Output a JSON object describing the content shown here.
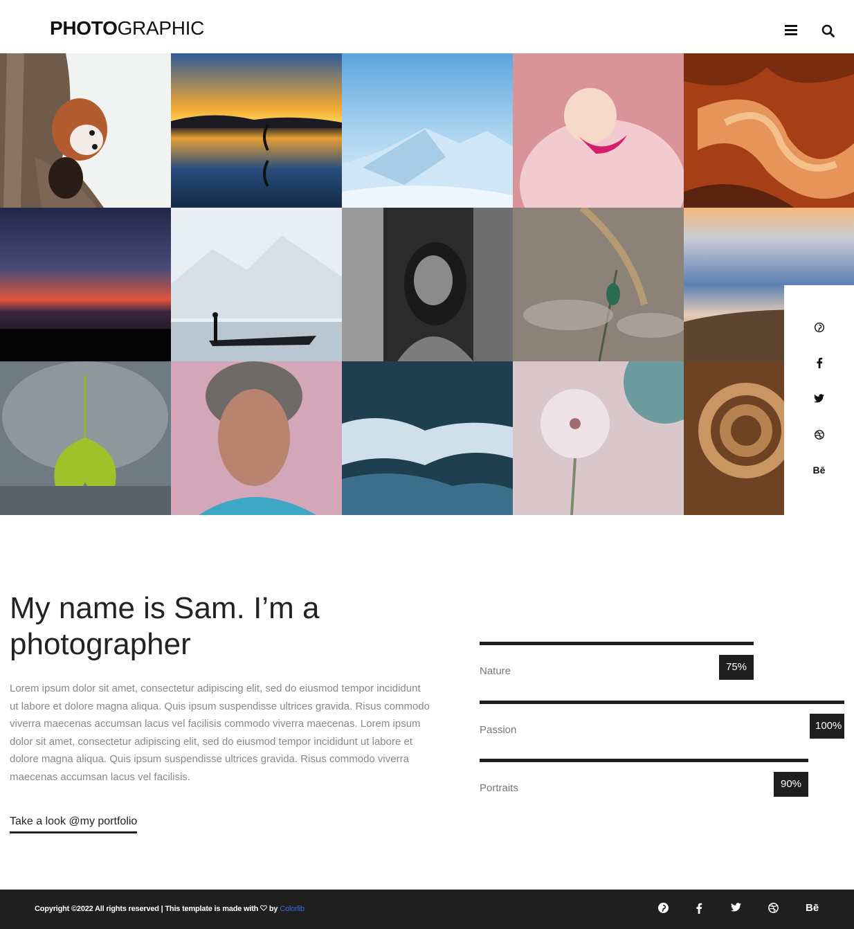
{
  "header": {
    "logo_bold": "PHOTO",
    "logo_light": "GRAPHIC",
    "menu_icon": "hamburger-menu-icon",
    "search_icon": "search-icon"
  },
  "gallery": {
    "photos": [
      "red-panda-in-tree",
      "sunset-lake-yoga-reflection",
      "snowy-mountains",
      "pink-flamingo",
      "antelope-canyon-rock",
      "starry-sky-red-sunset",
      "misty-lake-boatman",
      "girl-black-and-white",
      "dragonfly-on-stem",
      "clouds-above-mountains",
      "ginkgo-leaf-on-buddha",
      "elderly-woman-portrait",
      "ocean-waves",
      "pink-flower-closeup",
      "coiled-rope"
    ]
  },
  "side_social": {
    "icons": [
      "pinterest-icon",
      "facebook-icon",
      "twitter-icon",
      "dribbble-icon",
      "behance-icon"
    ],
    "behance_label": "Bē"
  },
  "about": {
    "title": "My name is Sam. I’m a photographer",
    "text": "Lorem ipsum dolor sit amet, consectetur adipiscing elit, sed do eiusmod tempor incididunt ut labore et dolore magna aliqua. Quis ipsum suspendisse ultrices gravida. Risus commodo viverra maecenas accumsan lacus vel facilisis commodo viverra maecenas. Lorem ipsum dolor sit amet, consectetur adipiscing elit, sed do eiusmod tempor incididunt ut labore et dolore magna aliqua. Quis ipsum suspendisse ultrices gravida. Risus commodo viverra maecenas accumsan lacus vel facilisis.",
    "link": "Take a look @my portfolio"
  },
  "skills": [
    {
      "label": "Nature",
      "percent": "75%",
      "value": 75
    },
    {
      "label": "Passion",
      "percent": "100%",
      "value": 100
    },
    {
      "label": "Portraits",
      "percent": "90%",
      "value": 90
    }
  ],
  "footer": {
    "copyright_prefix": "Copyright ©2022 All rights reserved | This template is made with ",
    "heart_icon": "heart-icon",
    "by": " by ",
    "brand": "Colorlib",
    "brand_color": "#2f6fe0",
    "social_icons": [
      "pinterest-icon",
      "facebook-icon",
      "twitter-icon",
      "dribbble-icon",
      "behance-icon"
    ],
    "behance_label": "Bē"
  }
}
